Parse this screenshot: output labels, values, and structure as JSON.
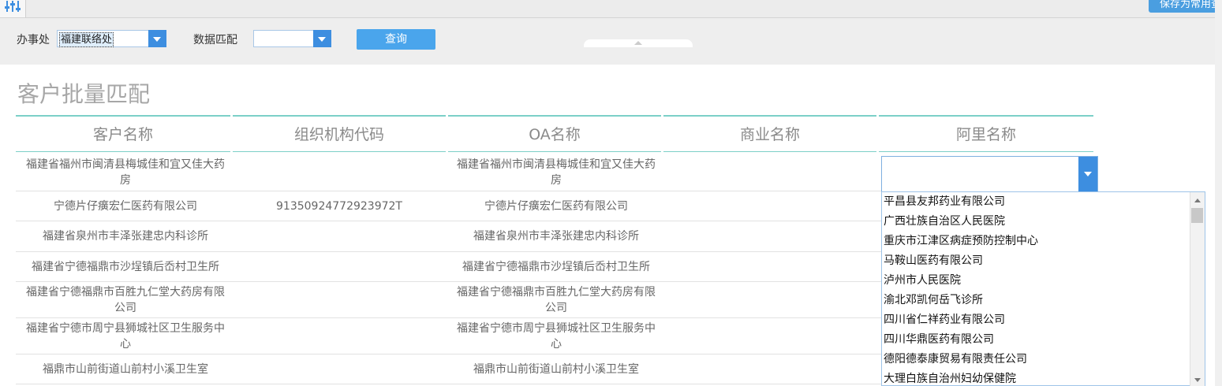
{
  "toolbar": {
    "filter_icon": "filter-sliders-icon",
    "save_common_label": "保存为常用查询"
  },
  "filters": {
    "office_label": "办事处",
    "office_value": "福建联络处",
    "match_label": "数据匹配",
    "match_value": "",
    "query_label": "查询"
  },
  "page_title": "客户批量匹配",
  "table": {
    "headers": [
      "客户名称",
      "组织机构代码",
      "OA名称",
      "商业名称",
      "阿里名称"
    ],
    "rows": [
      {
        "customer": [
          "福建省福州市闽清县梅城佳和宜又佳大药",
          "房"
        ],
        "org_code": "",
        "oa": [
          "福建省福州市闽清县梅城佳和宜又佳大药",
          "房"
        ],
        "biz": "",
        "ali": ""
      },
      {
        "customer": [
          "宁德片仔癀宏仁医药有限公司"
        ],
        "org_code": "91350924772923972T",
        "oa": [
          "宁德片仔癀宏仁医药有限公司"
        ],
        "biz": "",
        "ali": ""
      },
      {
        "customer": [
          "福建省泉州市丰泽张建忠内科诊所"
        ],
        "org_code": "",
        "oa": [
          "福建省泉州市丰泽张建忠内科诊所"
        ],
        "biz": "",
        "ali": ""
      },
      {
        "customer": [
          "福建省宁德福鼎市沙埕镇后岙村卫生所"
        ],
        "org_code": "",
        "oa": [
          "福建省宁德福鼎市沙埕镇后岙村卫生所"
        ],
        "biz": "",
        "ali": ""
      },
      {
        "customer": [
          "福建省宁德福鼎市百胜九仁堂大药房有限",
          "公司"
        ],
        "org_code": "",
        "oa": [
          "福建省宁德福鼎市百胜九仁堂大药房有限",
          "公司"
        ],
        "biz": "",
        "ali": ""
      },
      {
        "customer": [
          "福建省宁德市周宁县狮城社区卫生服务中",
          "心"
        ],
        "org_code": "",
        "oa": [
          "福建省宁德市周宁县狮城社区卫生服务中",
          "心"
        ],
        "biz": "",
        "ali": ""
      },
      {
        "customer": [
          "福鼎市山前街道山前村小溪卫生室"
        ],
        "org_code": "",
        "oa": [
          "福鼎市山前街道山前村小溪卫生室"
        ],
        "biz": "",
        "ali": ""
      }
    ]
  },
  "ali_dropdown": {
    "value": "",
    "options": [
      "平昌县友邦药业有限公司",
      "广西壮族自治区人民医院",
      "重庆市江津区病症预防控制中心",
      "马鞍山医药有限公司",
      "泸州市人民医院",
      "渝北邓凯何岳飞诊所",
      "四川省仁祥药业有限公司",
      "四川华鼎医药有限公司",
      "德阳德泰康贸易有限责任公司",
      "大理白族自治州妇幼保健院"
    ]
  },
  "colors": {
    "accent": "#3d8ee0",
    "button": "#4aa5ec",
    "teal_border": "#7cd0c8",
    "title_gray": "#a7a7a7"
  }
}
